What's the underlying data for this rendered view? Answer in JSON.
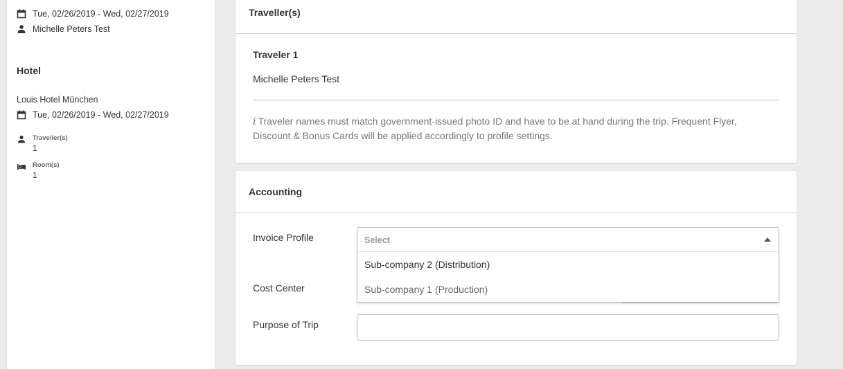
{
  "sidebar": {
    "flight": {
      "dates": "Tue, 02/26/2019 - Wed, 02/27/2019",
      "traveler": "Michelle Peters Test"
    },
    "hotel": {
      "heading": "Hotel",
      "name": "Louis Hotel München",
      "dates": "Tue, 02/26/2019 - Wed, 02/27/2019",
      "travellers_label": "Traveller(s)",
      "travellers_value": "1",
      "rooms_label": "Room(s)",
      "rooms_value": "1"
    }
  },
  "travellers_card": {
    "title": "Traveller(s)",
    "traveler_heading": "Traveler 1",
    "traveler_name": "Michelle Peters Test",
    "info_icon": "i",
    "note": "Traveler names must match government-issued photo ID and have to be at hand during the trip. Frequent Flyer, Discount & Bonus Cards will be applied accordingly to profile settings."
  },
  "accounting_card": {
    "title": "Accounting",
    "invoice_profile_label": "Invoice Profile",
    "invoice_profile_placeholder": "Select",
    "invoice_profile_options": [
      "Sub-company 2 (Distribution)",
      "Sub-company 1 (Production)"
    ],
    "cost_center_label": "Cost Center",
    "purpose_label": "Purpose of Trip",
    "purpose_value": ""
  },
  "icons": {
    "calendar": "calendar-icon",
    "person": "person-icon",
    "bed": "bed-icon",
    "caret": "caret-up-icon"
  },
  "colors": {
    "background": "#ececec",
    "card": "#ffffff",
    "text": "#333333",
    "muted": "#777777"
  }
}
